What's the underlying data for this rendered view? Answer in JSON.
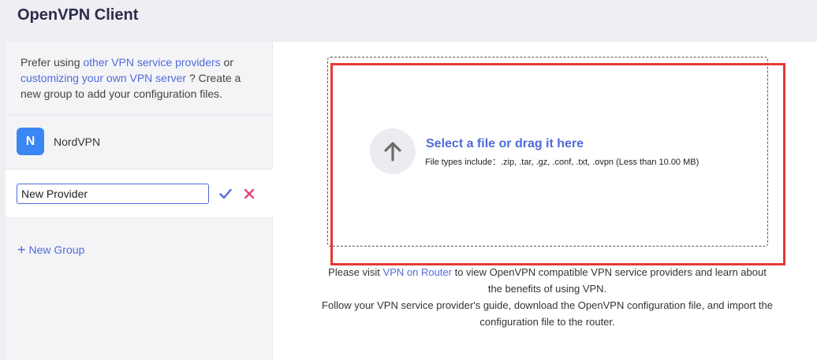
{
  "header": {
    "title": "OpenVPN Client"
  },
  "sidebar": {
    "intro": {
      "prefix": "Prefer using ",
      "link1": "other VPN service providers",
      "mid": " or ",
      "link2": "customizing your own VPN server",
      "suffix": " ? Create a new group to add your configuration files."
    },
    "provider": {
      "avatar_letter": "N",
      "name": "NordVPN",
      "avatar_color": "#3a86f2"
    },
    "edit": {
      "value": "New Provider"
    },
    "new_group_label": "New Group"
  },
  "main": {
    "dropzone": {
      "title": "Select a file or drag it here",
      "types": "File types include：.zip, .tar, .gz, .conf, .txt, .ovpn (Less than 10.00 MB)"
    },
    "help": {
      "p1_prefix": "Please visit ",
      "p1_link": "VPN on Router",
      "p1_suffix": " to view OpenVPN compatible VPN service providers and learn about the benefits of using VPN.",
      "p2": "Follow your VPN service provider's guide, download the OpenVPN configuration file, and import the configuration file to the router."
    }
  },
  "colors": {
    "accent": "#4f6bd8",
    "danger": "#e0457b",
    "highlight": "#e53935"
  }
}
